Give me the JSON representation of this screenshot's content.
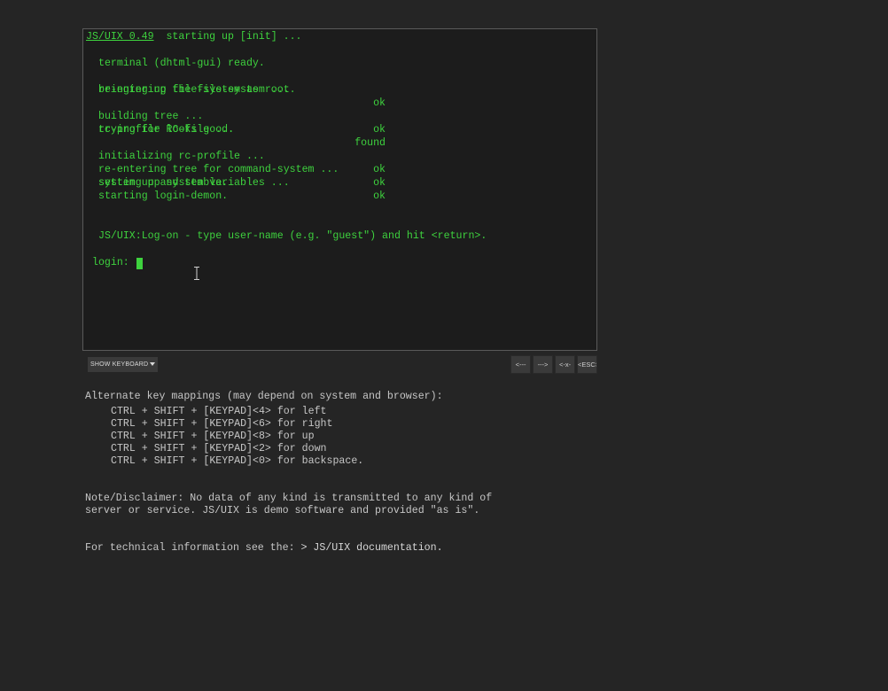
{
  "terminal": {
    "brand": "JS/UIX 0.49",
    "title_suffix": "  starting up [init] ...",
    "lines": [
      "terminal (dhtml-gui) ready.",
      "re-entering file-system as root.",
      "rc-profile looks good.",
      "system up and stable.",
      "starting login-demon.",
      "JS/UIX:Log-on - type user-name (e.g. \"guest\") and hit <return>."
    ],
    "status_rows": [
      {
        "label": "bringing up the file-system ...",
        "status": "ok"
      },
      {
        "label": "building tree ...",
        "status": "ok"
      },
      {
        "label": "trying for RC-file ...",
        "status": "found"
      },
      {
        "label": "initializing rc-profile ...",
        "status": "ok"
      },
      {
        "label": "re-entering tree for command-system ...",
        "status": "ok"
      },
      {
        "label": "setting up system variables ...",
        "status": "ok"
      }
    ],
    "prompt": "login: ",
    "text_color": "#3ed23e",
    "background": "#1c1c1c"
  },
  "controls": {
    "show_keyboard": "SHOW KEYBOARD",
    "left_key": "<---",
    "right_key": "--->",
    "backspace_key": "<-x-",
    "esc_key": "<ESC>"
  },
  "info": {
    "mappings_heading": "Alternate key mappings (may depend on system and browser):",
    "mappings": [
      "CTRL + SHIFT + [KEYPAD]<4> for left",
      "CTRL + SHIFT + [KEYPAD]<6> for right",
      "CTRL + SHIFT + [KEYPAD]<8> for up",
      "CTRL + SHIFT + [KEYPAD]<2> for down",
      "CTRL + SHIFT + [KEYPAD]<0> for backspace."
    ],
    "disclaimer_1": "Note/Disclaimer: No data of any kind is transmitted to any kind of",
    "disclaimer_2": "server or service. JS/UIX is demo software and provided \"as is\".",
    "tech_prefix": "For technical information see the: ",
    "tech_link": "> JS/UIX documentation."
  },
  "page_background": "#252525"
}
